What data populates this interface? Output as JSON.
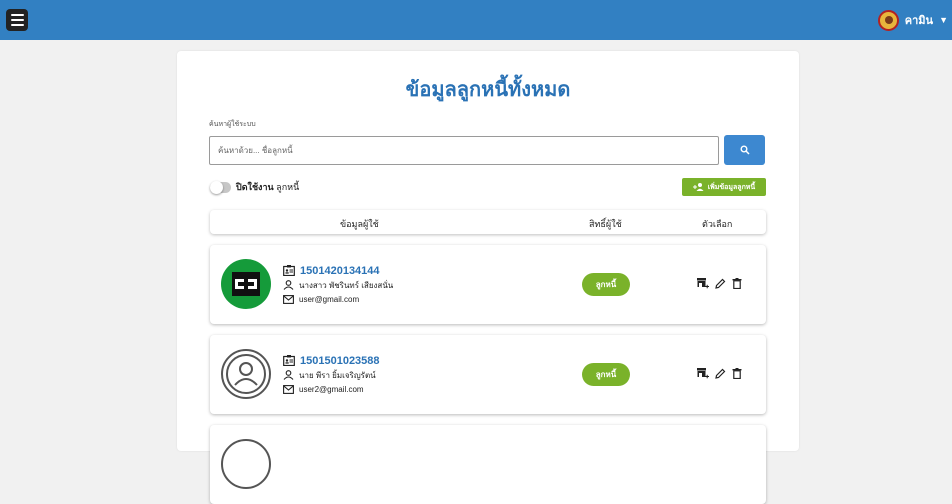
{
  "user": {
    "name": "คามิน"
  },
  "page": {
    "title": "ข้อมูลลูกหนี้ทั้งหมด"
  },
  "search": {
    "label": "ค้นหาผู้ใช้ระบบ",
    "placeholder": "ค้นหาด้วย... ชื่อลูกหนี้"
  },
  "toggle": {
    "bold": "ปิดใช้งาน",
    "rest": " ลูกหนี้"
  },
  "add_button": {
    "label": "เพิ่มข้อมูลลูกหนี้"
  },
  "table": {
    "headers": [
      "ข้อมูลผู้ใช้",
      "สิทธิ์ผู้ใช้",
      "ตัวเลือก"
    ],
    "rows": [
      {
        "id": "1501420134144",
        "name": "นางสาว พัชรินทร์ เสียงสนั่น",
        "email": "user@gmail.com",
        "role": "ลูกหนี้"
      },
      {
        "id": "1501501023588",
        "name": "นาย พีรา ยิ้มเจริญรัตน์",
        "email": "user2@gmail.com",
        "role": "ลูกหนี้"
      }
    ]
  },
  "colors": {
    "topbar": "#3280c2",
    "accent": "#2a72b5",
    "green": "#7ab22a"
  },
  "icons": [
    "menu-icon",
    "search-icon",
    "add-user-icon",
    "id-card-icon",
    "person-icon",
    "mail-icon",
    "shop-add-icon",
    "pencil-icon",
    "trash-icon"
  ]
}
